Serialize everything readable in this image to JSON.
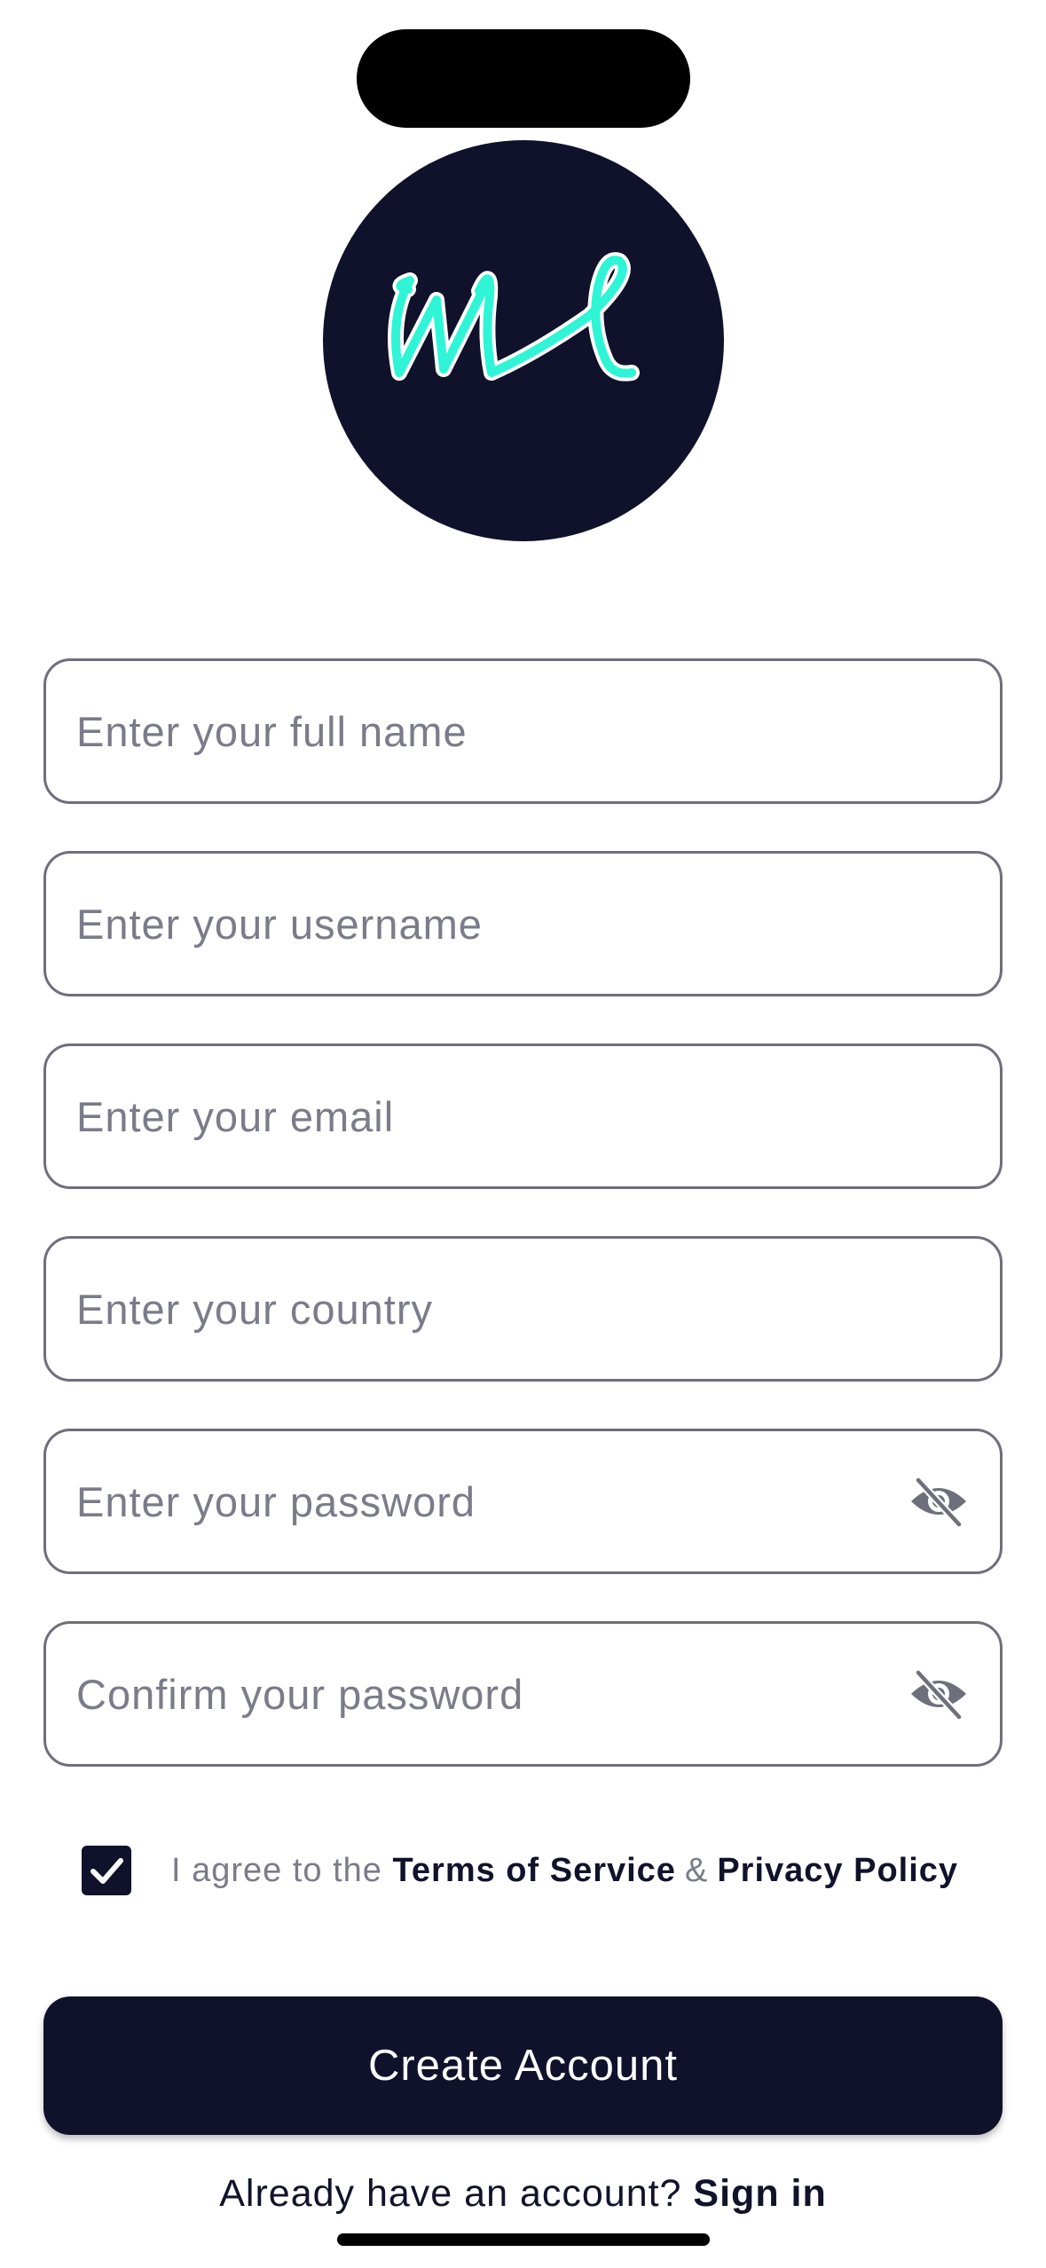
{
  "logo": {
    "text": "WL",
    "bg_color": "#10112a",
    "accent_color": "#2ff5d6"
  },
  "form": {
    "fields": [
      {
        "name": "full-name",
        "placeholder": "Enter your full name",
        "value": "",
        "type": "text"
      },
      {
        "name": "username",
        "placeholder": "Enter your username",
        "value": "",
        "type": "text"
      },
      {
        "name": "email",
        "placeholder": "Enter your email",
        "value": "",
        "type": "email"
      },
      {
        "name": "country",
        "placeholder": "Enter your country",
        "value": "",
        "type": "text"
      },
      {
        "name": "password",
        "placeholder": "Enter your password",
        "value": "",
        "type": "password",
        "icon": "eye-slash-icon"
      },
      {
        "name": "confirm-password",
        "placeholder": "Confirm your password",
        "value": "",
        "type": "password",
        "icon": "eye-slash-icon"
      }
    ]
  },
  "agreement": {
    "checked": true,
    "prefix": "I agree to the",
    "terms_label": "Terms of Service",
    "separator": "&",
    "privacy_label": "Privacy Policy"
  },
  "create_button": {
    "label": "Create Account"
  },
  "signin": {
    "prompt": "Already have an account?",
    "link_label": "Sign in"
  },
  "colors": {
    "primary": "#10112a",
    "border": "#6f6f7c",
    "placeholder": "#7b7b8a"
  }
}
